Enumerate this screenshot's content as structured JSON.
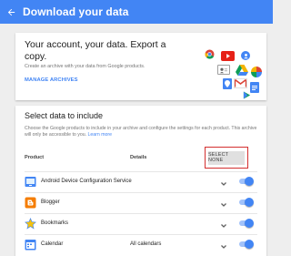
{
  "header": {
    "title": "Download your data",
    "back_icon": "arrow-back-icon",
    "color": "#4285f4"
  },
  "intro_card": {
    "title": "Your account, your data. Export a copy.",
    "description": "Create an archive with your data from Google products.",
    "manage_archives_label": "MANAGE ARCHIVES",
    "product_icons": [
      "chrome-icon",
      "youtube-icon",
      "profile-icon",
      "contacts-icon",
      "drive-icon",
      "photos-icon",
      "gmail-icon",
      "maps-icon",
      "docs-icon",
      "play-icon"
    ]
  },
  "select_card": {
    "title": "Select data to include",
    "description": "Choose the Google products to include in your archive and configure the settings for each product. This archive will only be accessible to you.",
    "learn_more": "Learn more",
    "columns": {
      "product": "Product",
      "details": "Details"
    },
    "select_none_label": "SELECT NONE",
    "highlight_color": "#d32f2f",
    "products": [
      {
        "name": "Android Device Configuration Service",
        "details": "",
        "icon": "android-icon",
        "included": true
      },
      {
        "name": "Blogger",
        "details": "",
        "icon": "blogger-icon",
        "included": true
      },
      {
        "name": "Bookmarks",
        "details": "",
        "icon": "bookmarks-star-icon",
        "included": true
      },
      {
        "name": "Calendar",
        "details": "All calendars",
        "icon": "calendar-icon",
        "included": true
      }
    ]
  }
}
